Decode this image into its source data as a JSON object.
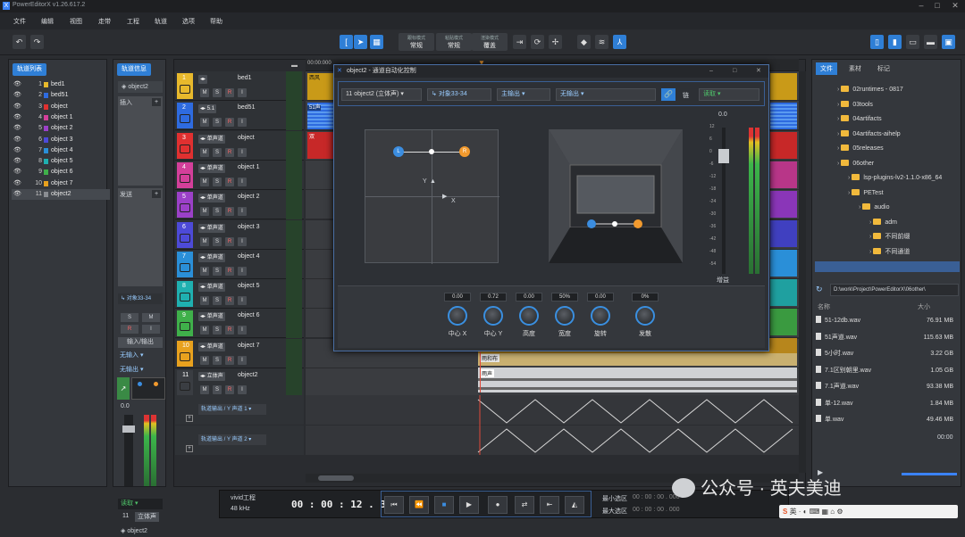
{
  "app": {
    "title": "PowerEditorX v1.26.617.2"
  },
  "menu": [
    "文件",
    "编辑",
    "视图",
    "走带",
    "工程",
    "轨道",
    "选项",
    "帮助"
  ],
  "toolbar": {
    "modes": [
      {
        "label": "跟标模式",
        "value": "常规"
      },
      {
        "label": "粘贴模式",
        "value": "常规"
      },
      {
        "label": "渲染模式",
        "value": "覆盖"
      }
    ]
  },
  "track_list": {
    "title": "轨道列表",
    "items": [
      {
        "num": "1",
        "name": "bed1",
        "color": "#e8b92c"
      },
      {
        "num": "2",
        "name": "bed51",
        "color": "#2e6be0"
      },
      {
        "num": "3",
        "name": "object",
        "color": "#e03030"
      },
      {
        "num": "4",
        "name": "object 1",
        "color": "#d43f9a"
      },
      {
        "num": "5",
        "name": "object 2",
        "color": "#9b40c8"
      },
      {
        "num": "6",
        "name": "object 3",
        "color": "#4d4ad8"
      },
      {
        "num": "7",
        "name": "object 4",
        "color": "#2a8fd8"
      },
      {
        "num": "8",
        "name": "object 5",
        "color": "#1fb0b0"
      },
      {
        "num": "9",
        "name": "object 6",
        "color": "#3fb04a"
      },
      {
        "num": "10",
        "name": "object 7",
        "color": "#e8a11e"
      },
      {
        "num": "11",
        "name": "object2",
        "color": "#8a8d92"
      }
    ]
  },
  "track_info": {
    "title": "轨道信息",
    "selected": "object2",
    "insert_label": "插入",
    "send_label": "发送",
    "route": "对象33-34",
    "s": "S",
    "m": "M",
    "r": "R",
    "i": "I",
    "io": "输入/输出",
    "input": "无输入",
    "output": "无输出",
    "gain": "0.0",
    "read": "读取",
    "num": "11",
    "ch": "立体声",
    "name": "object2"
  },
  "tracks": [
    {
      "num": "1",
      "ch": "",
      "name": "bed1",
      "color": "#e8b92c"
    },
    {
      "num": "2",
      "ch": "5.1",
      "name": "bed51",
      "color": "#2e6be0"
    },
    {
      "num": "3",
      "ch": "单声道",
      "name": "object",
      "color": "#e03030"
    },
    {
      "num": "4",
      "ch": "单声道",
      "name": "object 1",
      "color": "#d43f9a"
    },
    {
      "num": "5",
      "ch": "单声道",
      "name": "object 2",
      "color": "#9b40c8"
    },
    {
      "num": "6",
      "ch": "单声道",
      "name": "object 3",
      "color": "#4d4ad8"
    },
    {
      "num": "7",
      "ch": "单声道",
      "name": "object 4",
      "color": "#2a8fd8"
    },
    {
      "num": "8",
      "ch": "单声道",
      "name": "object 5",
      "color": "#1fb0b0"
    },
    {
      "num": "9",
      "ch": "单声道",
      "name": "object 6",
      "color": "#3fb04a"
    },
    {
      "num": "10",
      "ch": "单声道",
      "name": "object 7",
      "color": "#e8a11e"
    },
    {
      "num": "11",
      "ch": "立体声",
      "name": "object2",
      "color": "#3a3d42"
    }
  ],
  "automation": [
    {
      "label": "轨道输出 / Y 声道 1"
    },
    {
      "label": "轨道输出 / Y 声道 2"
    }
  ],
  "timeline": {
    "start": "00:00:000"
  },
  "clips": {
    "c1": "西风",
    "c2": "51声",
    "c3": "双",
    "c4": "雨和布",
    "c5": "雨声"
  },
  "dialog": {
    "title": "object2 - 通道自动化控制",
    "track_sel": "11 object2 (立体声)",
    "route_sel": "对象33-34",
    "output_sel": "主输出",
    "out2_sel": "无输出",
    "link_label": "链",
    "mode_sel": "读取",
    "gain_value": "0.0",
    "gain_label": "增益",
    "axis_y": "Y",
    "axis_x": "X",
    "ticks": [
      "12",
      "6",
      "0",
      "-6",
      "-12",
      "-18",
      "-24",
      "-30",
      "-36",
      "-42",
      "-48",
      "-54"
    ],
    "knobs": [
      {
        "value": "0.00",
        "label": "中心 X"
      },
      {
        "value": "0.72",
        "label": "中心 Y"
      },
      {
        "value": "0.00",
        "label": "高度"
      },
      {
        "value": "50%",
        "label": "宽度"
      },
      {
        "value": "0.00",
        "label": "旋转"
      },
      {
        "value": "0%",
        "label": "发散"
      }
    ]
  },
  "browser": {
    "tabs": [
      "文件",
      "素材",
      "标记"
    ],
    "tree": [
      {
        "name": "02runtimes - 0817",
        "depth": 0
      },
      {
        "name": "03tools",
        "depth": 0
      },
      {
        "name": "04artifacts",
        "depth": 0
      },
      {
        "name": "04artifacts-aihelp",
        "depth": 0
      },
      {
        "name": "05releases",
        "depth": 0
      },
      {
        "name": "06other",
        "depth": 0
      },
      {
        "name": "lsp-plugins-lv2-1.1.0-x86_64",
        "depth": 1
      },
      {
        "name": "PETest",
        "depth": 1
      },
      {
        "name": "audio",
        "depth": 2
      },
      {
        "name": "adm",
        "depth": 3
      },
      {
        "name": "不同前缀",
        "depth": 3
      },
      {
        "name": "不同通道",
        "depth": 3
      }
    ],
    "path": "D:\\work\\Project\\PowerEditorX\\06other\\",
    "col_name": "名称",
    "col_size": "大小",
    "files": [
      {
        "name": "51-12db.wav",
        "size": "76.91 MB"
      },
      {
        "name": "51声道.wav",
        "size": "115.63 MB"
      },
      {
        "name": "5小时.wav",
        "size": "3.22 GB"
      },
      {
        "name": "7.1区别朝里.wav",
        "size": "1.05 GB"
      },
      {
        "name": "7.1声道.wav",
        "size": "93.38 MB"
      },
      {
        "name": "单-12.wav",
        "size": "1.84 MB"
      },
      {
        "name": "单.wav",
        "size": "49.46 MB"
      }
    ],
    "time": "00:00"
  },
  "transport": {
    "project": "vivid工程",
    "rate": "48 kHz",
    "time": "00 : 00 : 12 . 304",
    "min_label": "最小选区",
    "max_label": "最大选区",
    "min_val": "00 : 00 : 00 . 000",
    "max_val": "00 : 00 : 00 . 000"
  },
  "watermark": {
    "text": "公众号 · 英夫美迪"
  },
  "ime": {
    "text": "英"
  }
}
